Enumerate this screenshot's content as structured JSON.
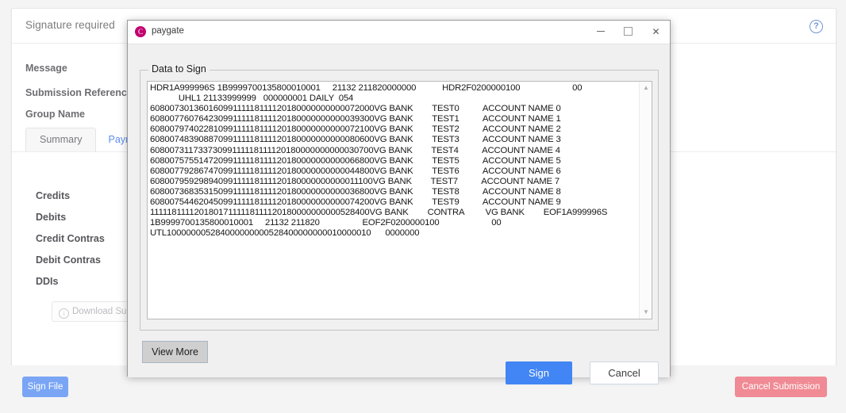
{
  "page": {
    "title": "Signature required",
    "help_icon": "question-mark-circle-icon",
    "fields": {
      "message": "Message",
      "submission_reference": "Submission Reference",
      "group_name": "Group Name"
    },
    "tabs": [
      {
        "label": "Summary",
        "active": true
      },
      {
        "label": "Payments",
        "active": false
      }
    ],
    "stats": [
      {
        "label": "Credits"
      },
      {
        "label": "Debits"
      },
      {
        "label": "Credit Contras"
      },
      {
        "label": "Debit Contras"
      },
      {
        "label": "DDIs"
      }
    ],
    "download_button": {
      "label": "Download Submis",
      "icon": "download-circle-icon",
      "disabled": true
    },
    "footer": {
      "sign_file_label": "Sign File",
      "cancel_submission_label": "Cancel Submission"
    },
    "colors": {
      "sign_file": "#7aa5f5",
      "cancel_submission": "#f08a94",
      "link": "#5b8def"
    }
  },
  "dialog": {
    "title": "paygate",
    "logo_icon": "paygate-logo-icon",
    "logo_color": "#c2036f",
    "window_controls": {
      "minimize": "minimize-icon",
      "maximize": "maximize-icon",
      "close": "close-icon"
    },
    "groupbox_legend": "Data to Sign",
    "data_to_sign": "HDR1A999996S 1B9999700135800010001     21132 211820000000           HDR2F0200000100                      00\n            UHL1 21133999999   000000001 DAILY  054\n60800730136016099111118111120180000000000072000VG BANK        TEST0          ACCOUNT NAME 0\n60800776076423099111118111120180000000000039300VG BANK        TEST1          ACCOUNT NAME 1\n60800797402281099111118111120180000000000072100VG BANK        TEST2          ACCOUNT NAME 2\n60800748390887099111118111120180000000000080600VG BANK        TEST3          ACCOUNT NAME 3\n60800731173373099111118111120180000000000030700VG BANK        TEST4          ACCOUNT NAME 4\n60800757551472099111118111120180000000000066800VG BANK        TEST5          ACCOUNT NAME 5\n60800779286747099111118111120180000000000044800VG BANK        TEST6          ACCOUNT NAME 6\n60800795929894099111118111120180000000000011100VG BANK        TEST7          ACCOUNT NAME 7\n60800736835315099111118111120180000000000036800VG BANK        TEST8          ACCOUNT NAME 8\n60800754462045099111118111120180000000000074200VG BANK        TEST9          ACCOUNT NAME 9\n11111811112018017111118111120180000000000528400VG BANK        CONTRA         VG BANK        EOF1A999996S\n1B9999700135800010001     21132 211820                  EOF2F0200000100                      00\nUTL100000005284000000000528400000000010000010      0000000",
    "scrollbar": {
      "up_arrow": "chevron-up-icon",
      "down_arrow": "chevron-down-icon"
    },
    "view_more_label": "View More",
    "sign_label": "Sign",
    "cancel_label": "Cancel",
    "colors": {
      "sign": "#4285f4"
    }
  }
}
